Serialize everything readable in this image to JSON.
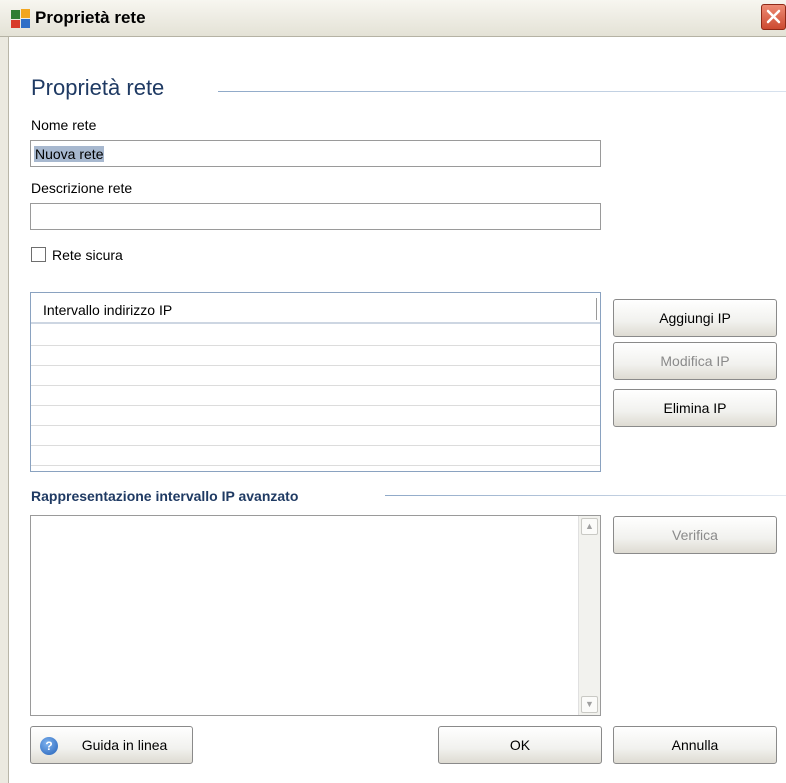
{
  "window": {
    "title": "Proprietà rete",
    "close_icon": "close-icon"
  },
  "page": {
    "title": "Proprietà rete"
  },
  "form": {
    "network_name_label": "Nome rete",
    "network_name_value": "Nuova rete",
    "network_description_label": "Descrizione rete",
    "network_description_value": "",
    "safe_network_label": "Rete sicura",
    "safe_network_checked": false
  },
  "ip_list": {
    "column_header": "Intervallo indirizzo IP",
    "rows": [
      "",
      "",
      "",
      "",
      "",
      "",
      ""
    ]
  },
  "ip_buttons": {
    "add": "Aggiungi IP",
    "edit": "Modifica IP",
    "delete": "Elimina IP"
  },
  "advanced": {
    "section_title": "Rappresentazione intervallo IP avanzato",
    "text": "",
    "verify_button": "Verifica"
  },
  "footer": {
    "help_button": "Guida in linea",
    "help_icon": "help-icon",
    "ok_button": "OK",
    "cancel_button": "Annulla"
  },
  "colors": {
    "heading": "#1f3a63",
    "selection": "#a7b8cf",
    "close_button": "#cc4a31"
  }
}
